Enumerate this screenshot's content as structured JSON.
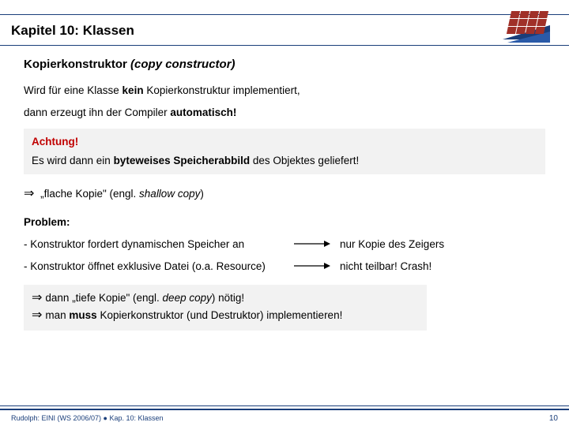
{
  "header": {
    "title": "Kapitel 10: Klassen"
  },
  "section": {
    "title_de": "Kopierkonstruktor",
    "title_en": "(copy constructor)"
  },
  "para1_a": "Wird für eine Klasse ",
  "para1_b": "kein",
  "para1_c": " Kopierkonstruktur implementiert,",
  "para2_a": "dann erzeugt ihn der Compiler ",
  "para2_b": "automatisch!",
  "warn_label": "Achtung!",
  "warn_a": "Es wird dann ein ",
  "warn_b": "byteweises Speicherabbild",
  "warn_c": " des Objektes geliefert!",
  "shallow_a": "„flache Kopie\" (engl. ",
  "shallow_b": "shallow copy",
  "shallow_c": ")",
  "problem_label": "Problem:",
  "rows": [
    {
      "left": "- Konstruktor fordert dynamischen Speicher an",
      "right": "nur Kopie des Zeigers"
    },
    {
      "left": "- Konstruktor öffnet exklusive Datei (o.a. Resource)",
      "right": "nicht teilbar! Crash!"
    }
  ],
  "conc1_a": "dann „tiefe Kopie\" (engl. ",
  "conc1_b": "deep copy",
  "conc1_c": ") nötig!",
  "conc2_a": "man ",
  "conc2_b": "muss",
  "conc2_c": " Kopierkonstruktor (und Destruktor) implementieren!",
  "footer": {
    "left": "Rudolph: EINI (WS 2006/07) ● Kap. 10: Klassen",
    "page": "10"
  }
}
